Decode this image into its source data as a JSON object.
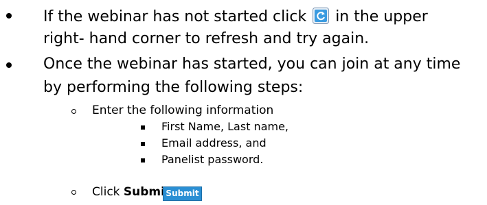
{
  "items": {
    "refresh": {
      "text_before": "If the webinar has not started click",
      "text_after": "in the upper",
      "continuation": "right- hand corner to refresh and try again.",
      "icon": "refresh-icon"
    },
    "join": {
      "line1": "Once the webinar has started, you can join at any time",
      "line2": "by performing the following steps:",
      "enter_info": "Enter the following information",
      "fields": [
        "First Name, Last name,",
        "Email address, and",
        "Panelist password."
      ],
      "click_prefix": "Click",
      "click_bold": "Submit",
      "click_suffix": ".",
      "submit_button_label": "Submit"
    }
  },
  "colors": {
    "submit_button": "#2a8fd4",
    "refresh_icon_bg": "#3a9be0"
  }
}
